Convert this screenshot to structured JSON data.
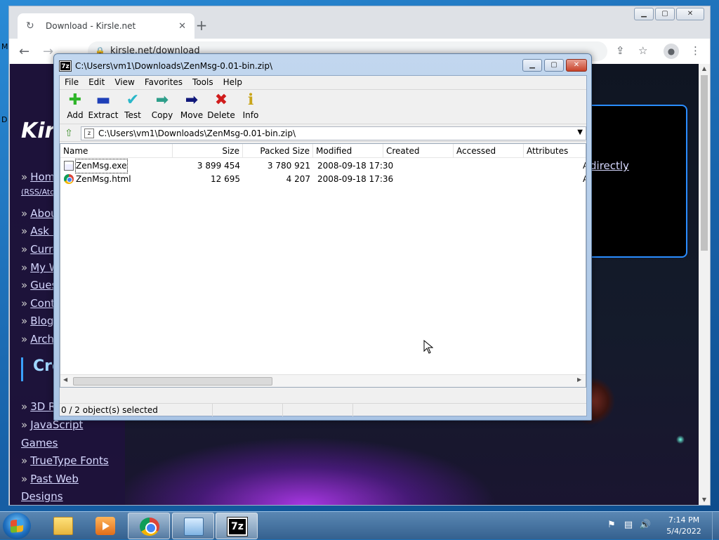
{
  "desktop": {
    "left_edge_letters": [
      "M",
      "D"
    ]
  },
  "chrome": {
    "tab_title": "Download - Kirsle.net",
    "tab_close": "✕",
    "new_tab": "+",
    "url": "kirsle.net/download",
    "window_controls": {
      "minimize": "▁",
      "maximize": "▢",
      "close": "✕"
    }
  },
  "webpage": {
    "site_title": "Kirs",
    "nav_links": [
      "Hom",
      "Abou",
      "Ask N",
      "Curre",
      "My W",
      "Gues",
      "Cont",
      "Blog",
      "Archi"
    ],
    "rss_text": "(RSS/Ato",
    "section_title": "Cre",
    "section_links": [
      "3D R",
      "JavaScript",
      "TrueType Fonts",
      "Past Web"
    ],
    "section_link_continuations": [
      "Games",
      "Designs"
    ],
    "info_link": "directly",
    "info_period": "."
  },
  "sevenzip": {
    "app_icon": "7z",
    "title": "C:\\Users\\vm1\\Downloads\\ZenMsg-0.01-bin.zip\\",
    "window_controls": {
      "minimize": "▁",
      "maximize": "▢",
      "close": "✕"
    },
    "menu": [
      "File",
      "Edit",
      "View",
      "Favorites",
      "Tools",
      "Help"
    ],
    "toolbar": [
      {
        "label": "Add",
        "icon": "plus-icon",
        "glyph": "✚",
        "color": "#2fb52a"
      },
      {
        "label": "Extract",
        "icon": "minus-icon",
        "glyph": "▬",
        "color": "#1e3fb8"
      },
      {
        "label": "Test",
        "icon": "check-icon",
        "glyph": "✔",
        "color": "#2ab7c9"
      },
      {
        "label": "Copy",
        "icon": "copy-arrow-icon",
        "glyph": "➡",
        "color": "#2d9e8a"
      },
      {
        "label": "Move",
        "icon": "move-arrow-icon",
        "glyph": "➡",
        "color": "#10187a"
      },
      {
        "label": "Delete",
        "icon": "delete-x-icon",
        "glyph": "✖",
        "color": "#d01c1c"
      },
      {
        "label": "Info",
        "icon": "info-icon",
        "glyph": "ℹ",
        "color": "#c9a51a"
      }
    ],
    "address_path": "C:\\Users\\vm1\\Downloads\\ZenMsg-0.01-bin.zip\\",
    "columns": [
      "Name",
      "Size",
      "Packed Size",
      "Modified",
      "Created",
      "Accessed",
      "Attributes"
    ],
    "files": [
      {
        "name": "ZenMsg.exe",
        "size": "3 899 454",
        "packed": "3 780 921",
        "modified": "2008-09-18 17:30",
        "created": "",
        "accessed": "",
        "attr": "A",
        "type": "exe"
      },
      {
        "name": "ZenMsg.html",
        "size": "12 695",
        "packed": "4 207",
        "modified": "2008-09-18 17:36",
        "created": "",
        "accessed": "",
        "attr": "A",
        "type": "html"
      }
    ],
    "status": "0 / 2 object(s) selected"
  },
  "taskbar": {
    "time": "7:14 PM",
    "date": "5/4/2022",
    "active_app": "7-Zip"
  },
  "colors": {
    "accent": "#2a8dff",
    "page_background": "#141b2b",
    "taskbar": "#35618f"
  }
}
